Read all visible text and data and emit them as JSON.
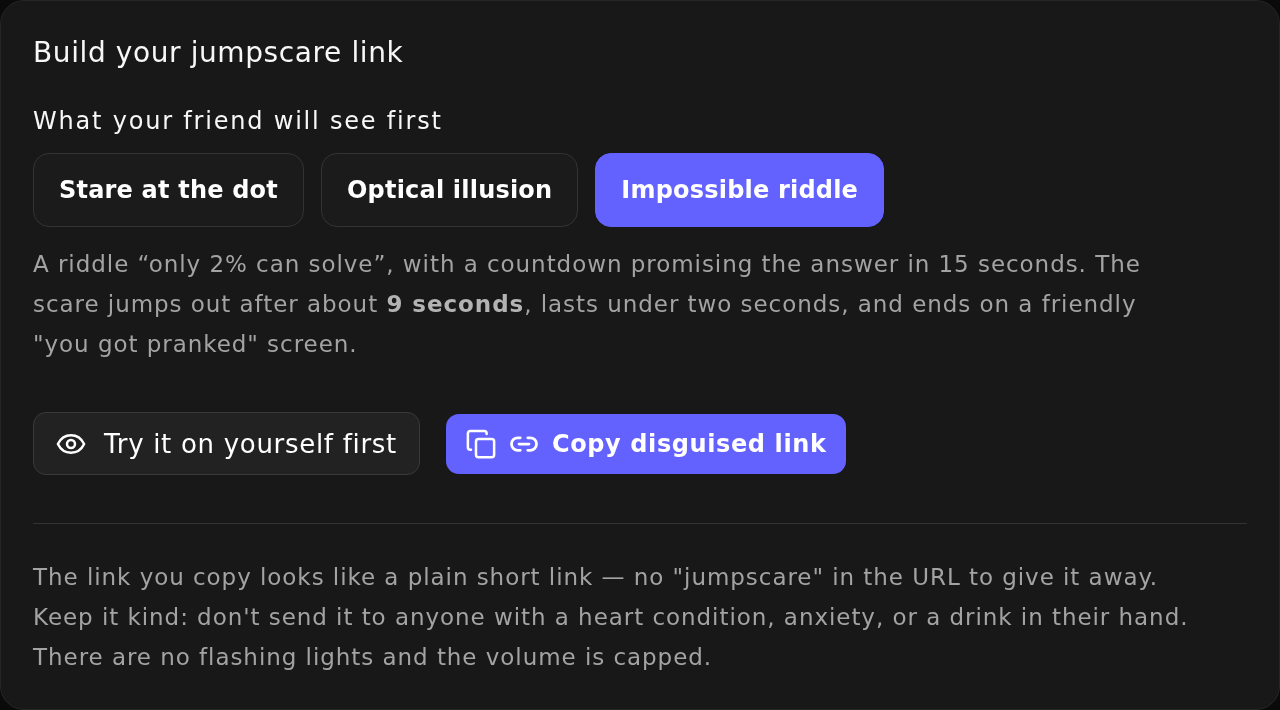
{
  "panel": {
    "title": "Build your jumpscare link"
  },
  "options": {
    "label": "What your friend will see first",
    "items": [
      {
        "label": "Stare at the dot",
        "selected": false
      },
      {
        "label": "Optical illusion",
        "selected": false
      },
      {
        "label": "Impossible riddle",
        "selected": true
      }
    ]
  },
  "description": "A riddle “only 2% can solve”, with a countdown promising the answer in 15 seconds. The scare jumps out after about **9 seconds**, lasts under two seconds, and ends on a friendly \"you got pranked\" screen.",
  "actions": [
    {
      "kind": "secondary",
      "label": "Try it on yourself first"
    },
    {
      "kind": "primary",
      "label": "Copy disguised link"
    }
  ],
  "notes": [
    "The link you copy looks like a plain short link — no \"jumpscare\" in the URL to give it away.",
    "Keep it kind: don't send it to anyone with a heart condition, anxiety, or a drink in their hand.",
    "There are no flashing lights and the volume is capped."
  ]
}
